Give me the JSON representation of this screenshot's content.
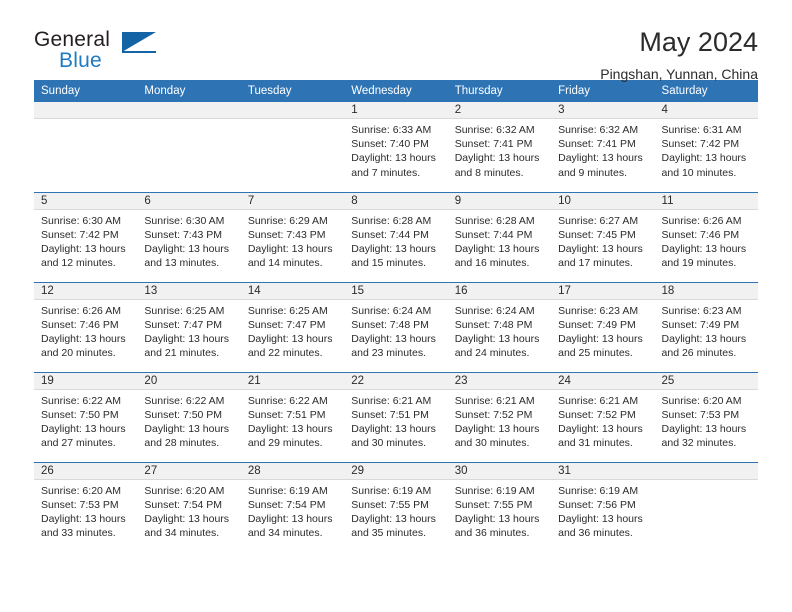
{
  "brand": {
    "name_top": "General",
    "name_bottom": "Blue",
    "logo_icon": "blue-triangle-logo",
    "accent_color": "#1464a5"
  },
  "header": {
    "title": "May 2024",
    "subtitle": "Pingshan, Yunnan, China"
  },
  "theme": {
    "header_blue": "#2e74b5",
    "daynum_band": "#f1f1f1",
    "text": "#2b2b2b"
  },
  "weekdays": [
    "Sunday",
    "Monday",
    "Tuesday",
    "Wednesday",
    "Thursday",
    "Friday",
    "Saturday"
  ],
  "leading_blanks": 3,
  "days": [
    {
      "day": "1",
      "sunrise": "Sunrise: 6:33 AM",
      "sunset": "Sunset: 7:40 PM",
      "daylight_line1": "Daylight: 13 hours",
      "daylight_line2": "and 7 minutes."
    },
    {
      "day": "2",
      "sunrise": "Sunrise: 6:32 AM",
      "sunset": "Sunset: 7:41 PM",
      "daylight_line1": "Daylight: 13 hours",
      "daylight_line2": "and 8 minutes."
    },
    {
      "day": "3",
      "sunrise": "Sunrise: 6:32 AM",
      "sunset": "Sunset: 7:41 PM",
      "daylight_line1": "Daylight: 13 hours",
      "daylight_line2": "and 9 minutes."
    },
    {
      "day": "4",
      "sunrise": "Sunrise: 6:31 AM",
      "sunset": "Sunset: 7:42 PM",
      "daylight_line1": "Daylight: 13 hours",
      "daylight_line2": "and 10 minutes."
    },
    {
      "day": "5",
      "sunrise": "Sunrise: 6:30 AM",
      "sunset": "Sunset: 7:42 PM",
      "daylight_line1": "Daylight: 13 hours",
      "daylight_line2": "and 12 minutes."
    },
    {
      "day": "6",
      "sunrise": "Sunrise: 6:30 AM",
      "sunset": "Sunset: 7:43 PM",
      "daylight_line1": "Daylight: 13 hours",
      "daylight_line2": "and 13 minutes."
    },
    {
      "day": "7",
      "sunrise": "Sunrise: 6:29 AM",
      "sunset": "Sunset: 7:43 PM",
      "daylight_line1": "Daylight: 13 hours",
      "daylight_line2": "and 14 minutes."
    },
    {
      "day": "8",
      "sunrise": "Sunrise: 6:28 AM",
      "sunset": "Sunset: 7:44 PM",
      "daylight_line1": "Daylight: 13 hours",
      "daylight_line2": "and 15 minutes."
    },
    {
      "day": "9",
      "sunrise": "Sunrise: 6:28 AM",
      "sunset": "Sunset: 7:44 PM",
      "daylight_line1": "Daylight: 13 hours",
      "daylight_line2": "and 16 minutes."
    },
    {
      "day": "10",
      "sunrise": "Sunrise: 6:27 AM",
      "sunset": "Sunset: 7:45 PM",
      "daylight_line1": "Daylight: 13 hours",
      "daylight_line2": "and 17 minutes."
    },
    {
      "day": "11",
      "sunrise": "Sunrise: 6:26 AM",
      "sunset": "Sunset: 7:46 PM",
      "daylight_line1": "Daylight: 13 hours",
      "daylight_line2": "and 19 minutes."
    },
    {
      "day": "12",
      "sunrise": "Sunrise: 6:26 AM",
      "sunset": "Sunset: 7:46 PM",
      "daylight_line1": "Daylight: 13 hours",
      "daylight_line2": "and 20 minutes."
    },
    {
      "day": "13",
      "sunrise": "Sunrise: 6:25 AM",
      "sunset": "Sunset: 7:47 PM",
      "daylight_line1": "Daylight: 13 hours",
      "daylight_line2": "and 21 minutes."
    },
    {
      "day": "14",
      "sunrise": "Sunrise: 6:25 AM",
      "sunset": "Sunset: 7:47 PM",
      "daylight_line1": "Daylight: 13 hours",
      "daylight_line2": "and 22 minutes."
    },
    {
      "day": "15",
      "sunrise": "Sunrise: 6:24 AM",
      "sunset": "Sunset: 7:48 PM",
      "daylight_line1": "Daylight: 13 hours",
      "daylight_line2": "and 23 minutes."
    },
    {
      "day": "16",
      "sunrise": "Sunrise: 6:24 AM",
      "sunset": "Sunset: 7:48 PM",
      "daylight_line1": "Daylight: 13 hours",
      "daylight_line2": "and 24 minutes."
    },
    {
      "day": "17",
      "sunrise": "Sunrise: 6:23 AM",
      "sunset": "Sunset: 7:49 PM",
      "daylight_line1": "Daylight: 13 hours",
      "daylight_line2": "and 25 minutes."
    },
    {
      "day": "18",
      "sunrise": "Sunrise: 6:23 AM",
      "sunset": "Sunset: 7:49 PM",
      "daylight_line1": "Daylight: 13 hours",
      "daylight_line2": "and 26 minutes."
    },
    {
      "day": "19",
      "sunrise": "Sunrise: 6:22 AM",
      "sunset": "Sunset: 7:50 PM",
      "daylight_line1": "Daylight: 13 hours",
      "daylight_line2": "and 27 minutes."
    },
    {
      "day": "20",
      "sunrise": "Sunrise: 6:22 AM",
      "sunset": "Sunset: 7:50 PM",
      "daylight_line1": "Daylight: 13 hours",
      "daylight_line2": "and 28 minutes."
    },
    {
      "day": "21",
      "sunrise": "Sunrise: 6:22 AM",
      "sunset": "Sunset: 7:51 PM",
      "daylight_line1": "Daylight: 13 hours",
      "daylight_line2": "and 29 minutes."
    },
    {
      "day": "22",
      "sunrise": "Sunrise: 6:21 AM",
      "sunset": "Sunset: 7:51 PM",
      "daylight_line1": "Daylight: 13 hours",
      "daylight_line2": "and 30 minutes."
    },
    {
      "day": "23",
      "sunrise": "Sunrise: 6:21 AM",
      "sunset": "Sunset: 7:52 PM",
      "daylight_line1": "Daylight: 13 hours",
      "daylight_line2": "and 30 minutes."
    },
    {
      "day": "24",
      "sunrise": "Sunrise: 6:21 AM",
      "sunset": "Sunset: 7:52 PM",
      "daylight_line1": "Daylight: 13 hours",
      "daylight_line2": "and 31 minutes."
    },
    {
      "day": "25",
      "sunrise": "Sunrise: 6:20 AM",
      "sunset": "Sunset: 7:53 PM",
      "daylight_line1": "Daylight: 13 hours",
      "daylight_line2": "and 32 minutes."
    },
    {
      "day": "26",
      "sunrise": "Sunrise: 6:20 AM",
      "sunset": "Sunset: 7:53 PM",
      "daylight_line1": "Daylight: 13 hours",
      "daylight_line2": "and 33 minutes."
    },
    {
      "day": "27",
      "sunrise": "Sunrise: 6:20 AM",
      "sunset": "Sunset: 7:54 PM",
      "daylight_line1": "Daylight: 13 hours",
      "daylight_line2": "and 34 minutes."
    },
    {
      "day": "28",
      "sunrise": "Sunrise: 6:19 AM",
      "sunset": "Sunset: 7:54 PM",
      "daylight_line1": "Daylight: 13 hours",
      "daylight_line2": "and 34 minutes."
    },
    {
      "day": "29",
      "sunrise": "Sunrise: 6:19 AM",
      "sunset": "Sunset: 7:55 PM",
      "daylight_line1": "Daylight: 13 hours",
      "daylight_line2": "and 35 minutes."
    },
    {
      "day": "30",
      "sunrise": "Sunrise: 6:19 AM",
      "sunset": "Sunset: 7:55 PM",
      "daylight_line1": "Daylight: 13 hours",
      "daylight_line2": "and 36 minutes."
    },
    {
      "day": "31",
      "sunrise": "Sunrise: 6:19 AM",
      "sunset": "Sunset: 7:56 PM",
      "daylight_line1": "Daylight: 13 hours",
      "daylight_line2": "and 36 minutes."
    }
  ]
}
